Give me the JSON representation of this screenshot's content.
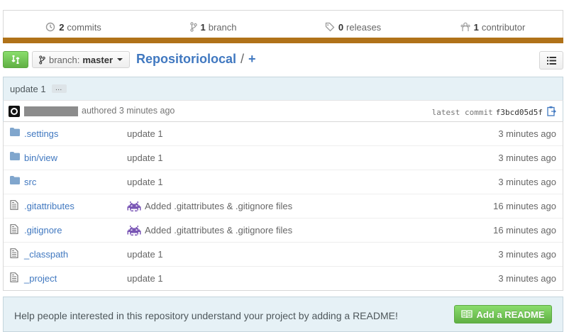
{
  "stats": {
    "commits": {
      "count": "2",
      "label": "commits",
      "icon": "history-icon"
    },
    "branches": {
      "count": "1",
      "label": "branch",
      "icon": "branch-icon"
    },
    "releases": {
      "count": "0",
      "label": "releases",
      "icon": "tag-icon"
    },
    "contributors": {
      "count": "1",
      "label": "contributor",
      "icon": "organization-icon"
    }
  },
  "language_bar_color": "#b07219",
  "toolbar": {
    "branch_label": "branch:",
    "branch_value": "master",
    "repo_name": "Repositoriolocal",
    "separator": "/",
    "new_file": "+"
  },
  "commit": {
    "title": "update 1",
    "ellipsis": "…",
    "authored": "authored 3 minutes ago",
    "latest_label": "latest commit",
    "sha": "f3bcd05d5f"
  },
  "files": [
    {
      "type": "dir",
      "name": ".settings",
      "message": "update 1",
      "age": "3 minutes ago"
    },
    {
      "type": "dir",
      "name": "bin/view",
      "message": "update 1",
      "age": "3 minutes ago"
    },
    {
      "type": "dir",
      "name": "src",
      "message": "update 1",
      "age": "3 minutes ago"
    },
    {
      "type": "file",
      "name": ".gitattributes",
      "message": "Added .gitattributes & .gitignore files",
      "age": "16 minutes ago",
      "emoji": "space-invader-icon"
    },
    {
      "type": "file",
      "name": ".gitignore",
      "message": "Added .gitattributes & .gitignore files",
      "age": "16 minutes ago",
      "emoji": "space-invader-icon"
    },
    {
      "type": "file",
      "name": "_classpath",
      "message": "update 1",
      "age": "3 minutes ago"
    },
    {
      "type": "file",
      "name": "_project",
      "message": "update 1",
      "age": "3 minutes ago"
    }
  ],
  "readme": {
    "prompt": "Help people interested in this repository understand your project by adding a README!",
    "button": "Add a README"
  },
  "colors": {
    "link": "#4078c0",
    "green": "#60b044",
    "commit_bg": "#e6f1f6"
  }
}
